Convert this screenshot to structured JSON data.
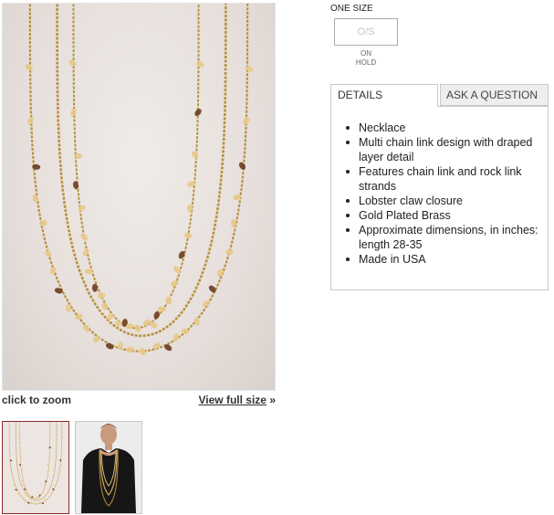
{
  "product_image": {
    "zoom_hint": "click to zoom",
    "view_full_size": "View full size",
    "view_full_size_arrow": "»",
    "main_image_icon": "necklace-photo",
    "thumbnails": [
      {
        "icon": "necklace-thumbnail",
        "selected": true
      },
      {
        "icon": "model-wearing-necklace-thumbnail",
        "selected": false
      }
    ]
  },
  "size": {
    "label": "ONE SIZE",
    "option": "O/S",
    "status_line1": "ON",
    "status_line2": "HOLD"
  },
  "tabs": {
    "details": "DETAILS",
    "ask": "ASK A QUESTION"
  },
  "details": [
    "Necklace",
    "Multi chain link design with draped layer detail",
    "Features chain link and rock link strands",
    "Lobster claw closure",
    "Gold Plated Brass",
    "Approximate dimensions, in inches: length 28-35",
    "Made in USA"
  ],
  "colors": {
    "chain": "#b8913f",
    "stone_amber": "#e7c98a",
    "stone_brown": "#6b3b1f",
    "selected_thumb_border": "#8b2a2a"
  }
}
